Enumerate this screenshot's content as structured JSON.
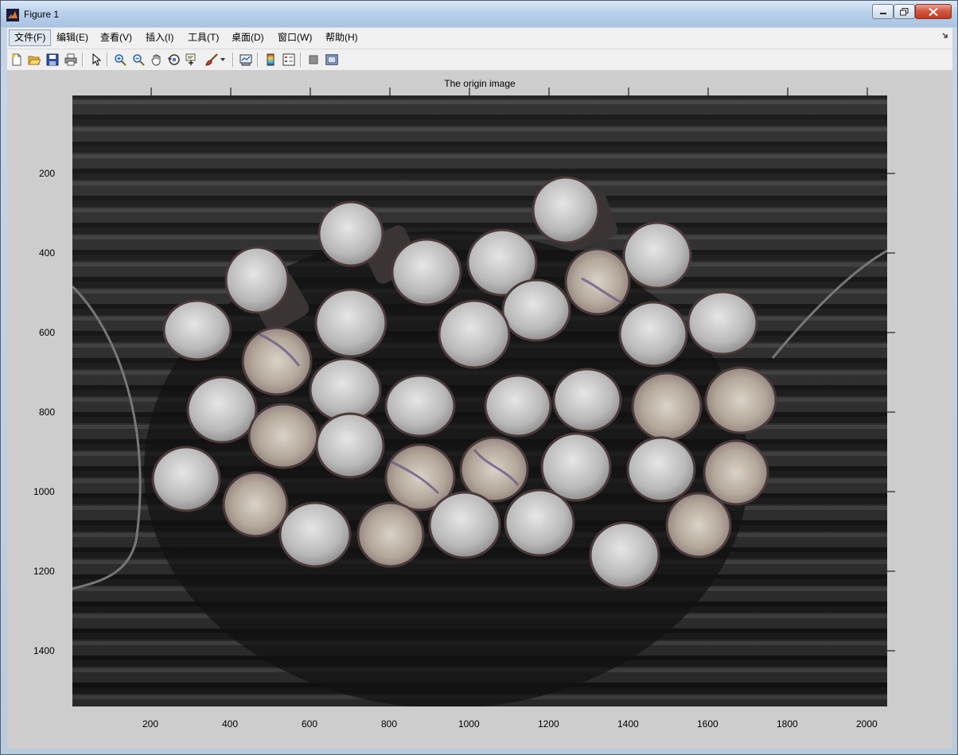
{
  "window": {
    "title": "Figure 1",
    "minimize_icon": "minimize-icon",
    "maximize_icon": "restore-icon",
    "close_icon": "close-icon"
  },
  "menu": {
    "items": [
      {
        "label": "文件(F)",
        "name": "menu-file"
      },
      {
        "label": "编辑(E)",
        "name": "menu-edit"
      },
      {
        "label": "查看(V)",
        "name": "menu-view"
      },
      {
        "label": "插入(I)",
        "name": "menu-insert"
      },
      {
        "label": "工具(T)",
        "name": "menu-tools"
      },
      {
        "label": "桌面(D)",
        "name": "menu-desktop"
      },
      {
        "label": "窗口(W)",
        "name": "menu-window"
      },
      {
        "label": "帮助(H)",
        "name": "menu-help"
      }
    ]
  },
  "toolbar": {
    "icons": [
      "new-figure-icon",
      "open-file-icon",
      "save-icon",
      "print-icon",
      "select-arrow-icon",
      "zoom-in-icon",
      "zoom-out-icon",
      "pan-hand-icon",
      "rotate-3d-icon",
      "data-cursor-icon",
      "brush-icon",
      "brush-dropdown-icon",
      "link-plot-icon",
      "colorbar-icon",
      "legend-icon",
      "hide-plot-tools-icon",
      "show-plot-tools-icon"
    ]
  },
  "plot": {
    "title": "The origin image",
    "x_ticks": [
      "200",
      "400",
      "600",
      "800",
      "1000",
      "1200",
      "1400",
      "1600",
      "1800",
      "2000"
    ],
    "y_ticks": [
      "200",
      "400",
      "600",
      "800",
      "1000",
      "1200",
      "1400"
    ],
    "image_description_icon": "photo-steel-rebar-ends-icon"
  },
  "colors": {
    "figure_bg": "#cdcdcd",
    "title_bar": "#b9d1ea",
    "close_button": "#c13a23"
  }
}
